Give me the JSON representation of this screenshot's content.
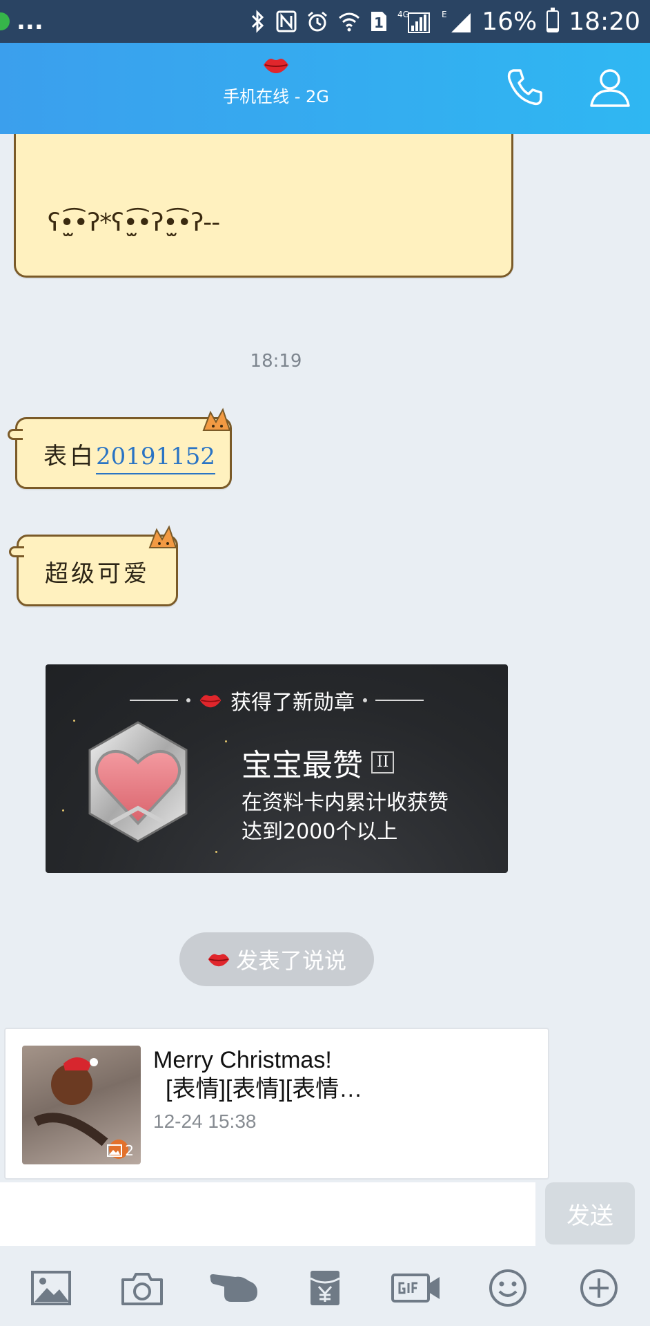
{
  "status_bar": {
    "left_text": "...",
    "lte_label": "4G",
    "edge_label": "E",
    "battery_percent": "16%",
    "battery_level": 0.16,
    "time": "18:20",
    "sim_slot": "1",
    "icons": [
      "bluetooth-icon",
      "nfc-icon",
      "alarm-icon",
      "wifi-icon",
      "sim-icon",
      "signal-icon",
      "battery-icon"
    ]
  },
  "header": {
    "status_text": "手机在线 - 2G",
    "avatar_icon": "lips-icon",
    "call_icon": "phone-icon",
    "profile_icon": "profile-icon"
  },
  "messages": {
    "kaomoji": "ʕ•̫͡•ʔ*ʕ•̫͡•ʔ•̫͡•ʔ--",
    "time_separator": "18:19",
    "msg1_prefix": "表白",
    "msg1_link": "20191152",
    "msg2_text": "超级可爱"
  },
  "badge_card": {
    "title": "获得了新勋章",
    "badge_name": "宝宝最赞",
    "level": "II",
    "desc_line1": "在资料卡内累计收获赞",
    "desc_line2": "达到2000个以上"
  },
  "status_pill": {
    "text": "发表了说说"
  },
  "post": {
    "title_line1": "Merry Christmas!",
    "title_line2": "[表情][表情][表情…",
    "time": "12-24 15:38",
    "image_count": "2"
  },
  "input": {
    "placeholder": "",
    "send_label": "发送"
  },
  "toolbar": {
    "items": [
      "image-icon",
      "camera-icon",
      "poke-icon",
      "red-packet-icon",
      "gif-icon",
      "emoji-icon",
      "plus-icon"
    ]
  },
  "colors": {
    "header_start": "#3b9fed",
    "header_end": "#2fb7f2",
    "bubble_fill": "#fff1bf",
    "link": "#2a74c4",
    "accent_red": "#e0262c"
  }
}
